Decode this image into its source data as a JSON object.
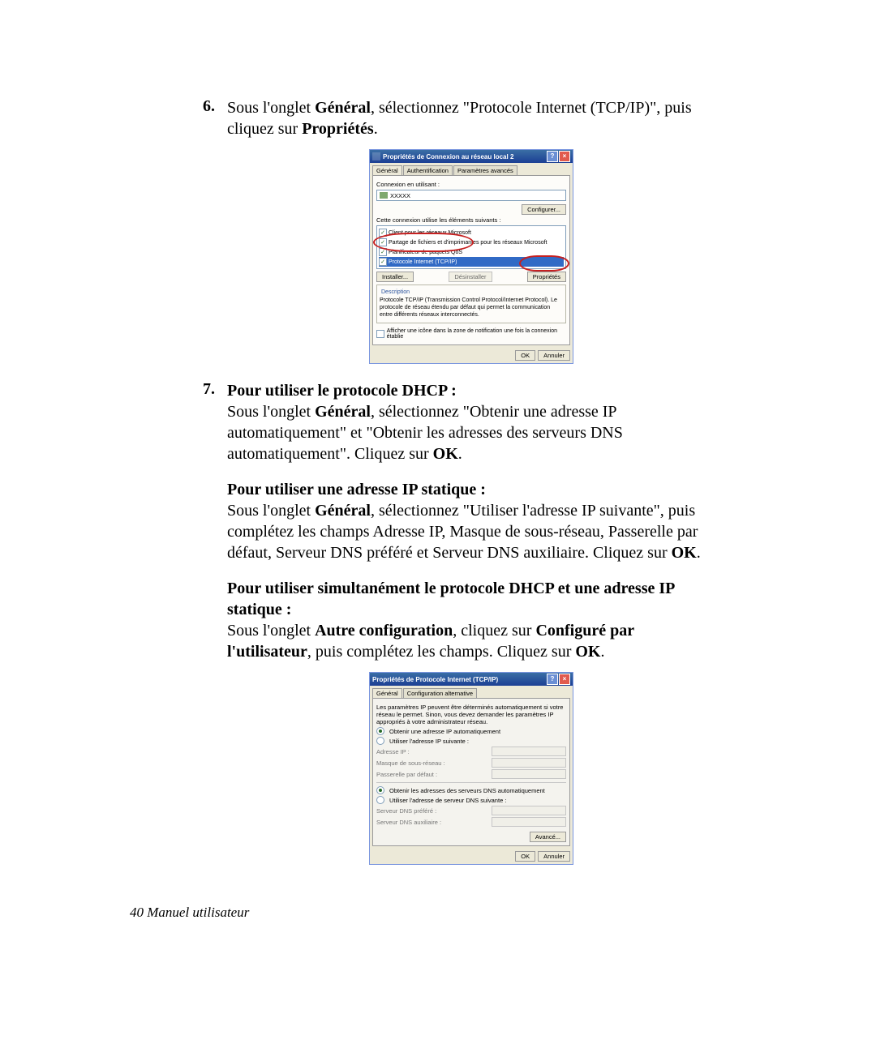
{
  "instructions": {
    "item6": {
      "num": "6.",
      "text_pre": "Sous l'onglet ",
      "b1": "Général",
      "text_mid": ", sélectionnez \"Protocole Internet (TCP/IP)\", puis cliquez sur ",
      "b2": "Propriétés",
      "text_end": "."
    },
    "item7": {
      "num": "7.",
      "h1": "Pour utiliser le protocole DHCP :",
      "p1_pre": "Sous l'onglet ",
      "p1_b1": "Général",
      "p1_mid": ", sélectionnez \"Obtenir une adresse IP automatiquement\" et \"Obtenir les adresses des serveurs DNS automatiquement\". Cliquez sur ",
      "p1_b2": "OK",
      "p1_end": ".",
      "h2": "Pour utiliser une adresse IP statique :",
      "p2_pre": "Sous l'onglet ",
      "p2_b1": "Général",
      "p2_mid": ", sélectionnez \"Utiliser l'adresse IP suivante\", puis complétez les champs Adresse IP, Masque de sous-réseau, Passerelle par défaut, Serveur DNS préféré et Serveur DNS auxiliaire. Cliquez sur ",
      "p2_b2": "OK",
      "p2_end": ".",
      "h3": "Pour utiliser simultanément le protocole DHCP et une adresse IP statique :",
      "p3_pre": "Sous l'onglet ",
      "p3_b1": "Autre configuration",
      "p3_mid": ", cliquez sur ",
      "p3_b2": "Configuré par l'utilisateur",
      "p3_mid2": ", puis complétez les champs. Cliquez sur ",
      "p3_b3": "OK",
      "p3_end": "."
    }
  },
  "dialog1": {
    "title": "Propriétés de Connexion au réseau local 2",
    "tabs": [
      "Général",
      "Authentification",
      "Paramètres avancés"
    ],
    "lbl_connect_using": "Connexion en utilisant :",
    "adapter": "XXXXX",
    "btn_configure": "Configurer...",
    "lbl_uses": "Cette connexion utilise les éléments suivants :",
    "items": [
      "Client pour les réseaux Microsoft",
      "Partage de fichiers et d'imprimantes pour les réseaux Microsoft",
      "Planificateur de paquets QoS",
      "Protocole Internet (TCP/IP)"
    ],
    "btn_install": "Installer...",
    "btn_uninstall": "Désinstaller",
    "btn_props": "Propriétés",
    "desc_title": "Description",
    "desc_text": "Protocole TCP/IP (Transmission Control Protocol/Internet Protocol). Le protocole de réseau étendu par défaut qui permet la communication entre différents réseaux interconnectés.",
    "show_icon": "Afficher une icône dans la zone de notification une fois la connexion établie",
    "btn_ok": "OK",
    "btn_cancel": "Annuler"
  },
  "dialog2": {
    "title": "Propriétés de Protocole Internet (TCP/IP)",
    "tabs": [
      "Général",
      "Configuration alternative"
    ],
    "intro": "Les paramètres IP peuvent être déterminés automatiquement si votre réseau le permet. Sinon, vous devez demander les paramètres IP appropriés à votre administrateur réseau.",
    "r_auto_ip": "Obtenir une adresse IP automatiquement",
    "r_manual_ip": "Utiliser l'adresse IP suivante :",
    "f_ip": "Adresse IP :",
    "f_mask": "Masque de sous-réseau :",
    "f_gw": "Passerelle par défaut :",
    "r_auto_dns": "Obtenir les adresses des serveurs DNS automatiquement",
    "r_manual_dns": "Utiliser l'adresse de serveur DNS suivante :",
    "f_dns1": "Serveur DNS préféré :",
    "f_dns2": "Serveur DNS auxiliaire :",
    "btn_adv": "Avancé...",
    "btn_ok": "OK",
    "btn_cancel": "Annuler"
  },
  "footer": "40  Manuel utilisateur"
}
